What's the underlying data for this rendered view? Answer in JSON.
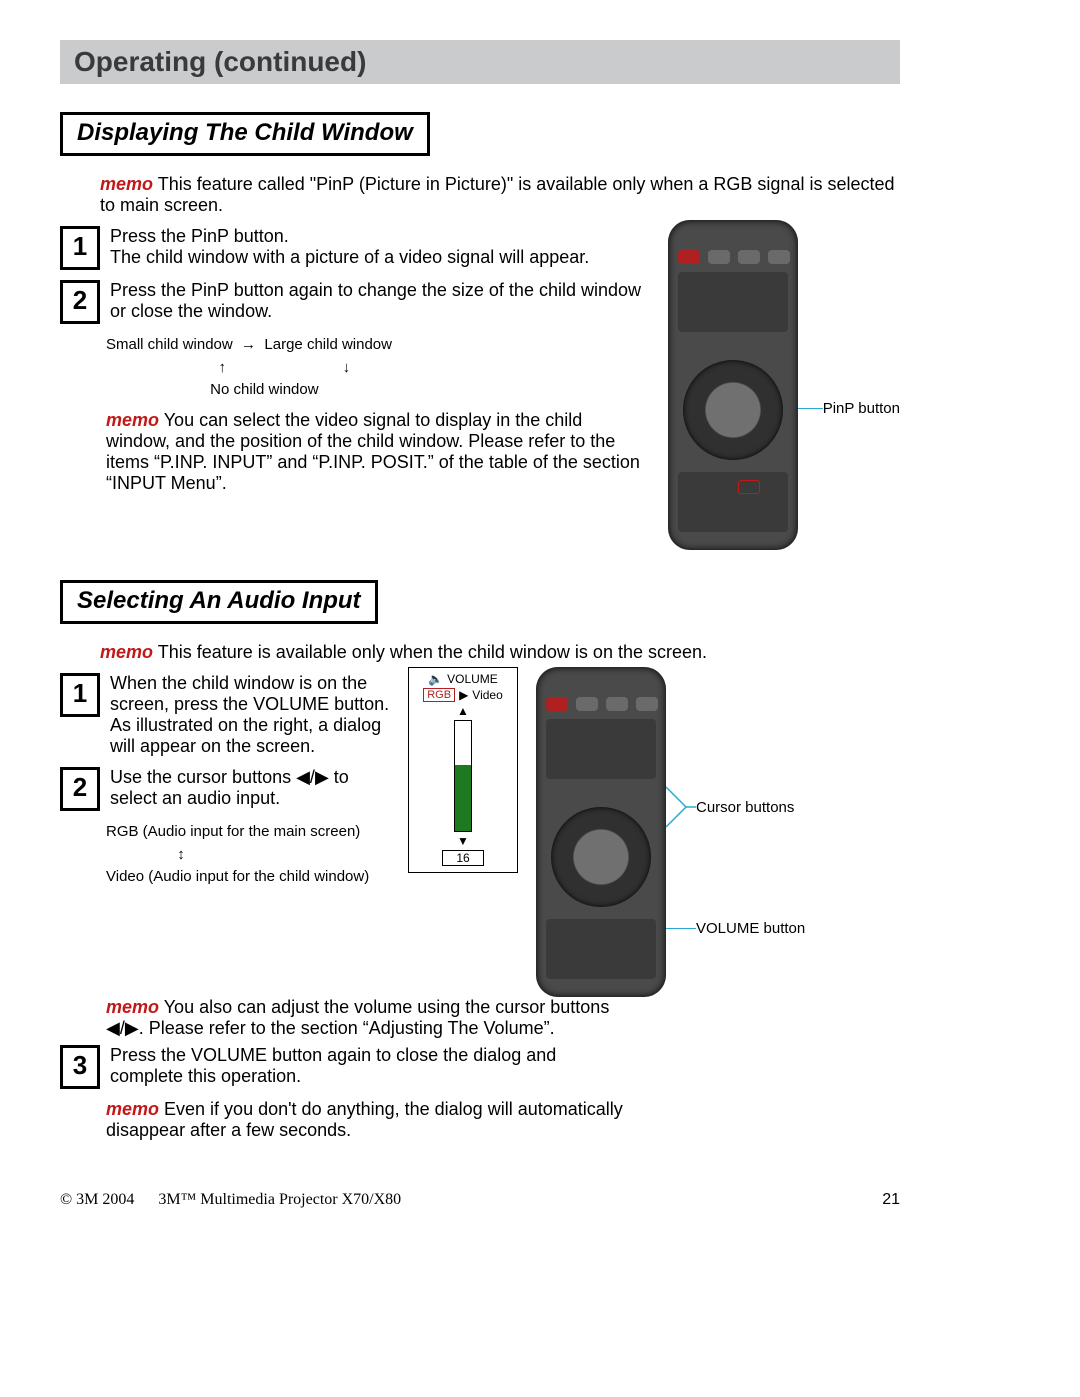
{
  "header": "Operating (continued)",
  "section1": {
    "title": "Displaying The Child Window",
    "memo1_label": "memo",
    "memo1": "This feature called \"PinP (Picture in Picture)\" is available only when a RGB signal is selected to main screen.",
    "step1_num": "1",
    "step1_a": "Press the PinP button.",
    "step1_b": "The child window with a picture of a video signal will appear.",
    "step2_num": "2",
    "step2": "Press the PinP button again to change the size of the child window or close the window.",
    "cycle_small": "Small child window",
    "cycle_large": "Large child window",
    "cycle_none": "No child window",
    "memo2_label": "memo",
    "memo2": "You can select the video signal to display in the child window, and the position of the child window. Please refer to the items “P.INP. INPUT” and “P.INP. POSIT.” of the table of the section “INPUT Menu”.",
    "callout_pinp": "PinP button"
  },
  "section2": {
    "title": "Selecting An Audio Input",
    "memo1_label": "memo",
    "memo1": "This feature is available only when the child window is on the screen.",
    "step1_num": "1",
    "step1": "When the child window is on the screen, press the VOLUME button. As illustrated on the right, a dialog will appear on the screen.",
    "step2_num": "2",
    "step2_a": "Use the cursor buttons ",
    "step2_b": " to select an audio input.",
    "audio_rgb": "RGB (Audio input for the main screen)",
    "audio_video": "Video (Audio input for the child window)",
    "memo2_label": "memo",
    "memo2_a": "You also can adjust the volume using the cursor buttons ",
    "memo2_b": ". Please refer to the section “Adjusting The Volume”.",
    "step3_num": "3",
    "step3": "Press the VOLUME button again to close the dialog and complete this operation.",
    "memo3_label": "memo",
    "memo3": "Even if you don't do anything, the dialog will automatically disappear after a few seconds.",
    "vol_title": "VOLUME",
    "vol_rgb": "RGB",
    "vol_video": "Video",
    "vol_value": "16",
    "callout_cursor": "Cursor buttons",
    "callout_volume": "VOLUME button"
  },
  "footer": {
    "copyright": "© 3M 2004",
    "model": "3M™ Multimedia Projector X70/X80",
    "page": "21"
  }
}
